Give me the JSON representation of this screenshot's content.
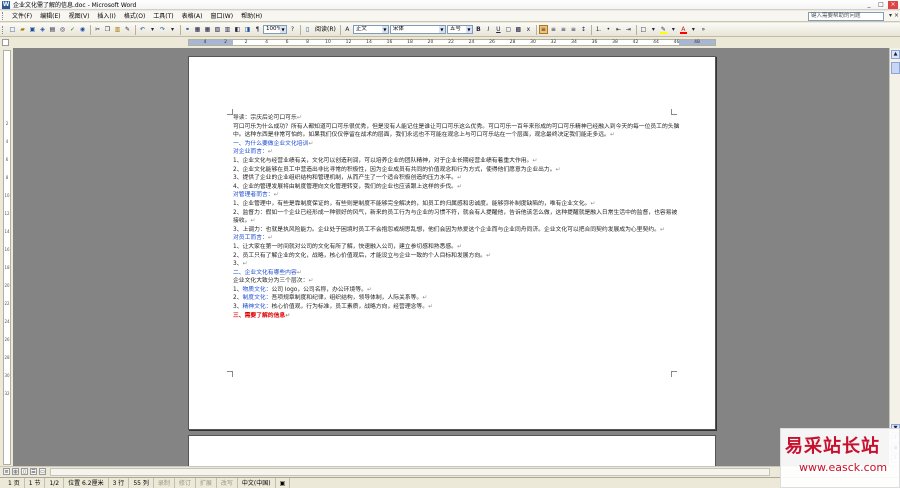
{
  "window": {
    "title": "企业文化需了解的信息.doc - Microsoft Word",
    "controls": [
      "_",
      "□",
      "×"
    ]
  },
  "menu": {
    "items": [
      "文件(F)",
      "编辑(E)",
      "视图(V)",
      "插入(I)",
      "格式(O)",
      "工具(T)",
      "表格(A)",
      "窗口(W)",
      "帮助(H)"
    ],
    "help_placeholder": "键入需要帮助的问题"
  },
  "toolbar": {
    "zoom": "100%",
    "read_label": "阅读(R)",
    "style": "正文",
    "font": "宋体",
    "size": "五号",
    "bold": "B",
    "italic": "I",
    "underline": "U",
    "font_color_label": "A",
    "highlight_color": "#ffff00",
    "font_color": "#ff0000"
  },
  "ruler": {
    "ticks": [
      "4",
      "2",
      "2",
      "4",
      "6",
      "8",
      "10",
      "12",
      "14",
      "16",
      "18",
      "20",
      "22",
      "24",
      "26",
      "28",
      "30",
      "32",
      "34",
      "36",
      "38",
      "42",
      "44",
      "46",
      "48"
    ]
  },
  "vruler": {
    "ticks": [
      "2",
      "4",
      "6",
      "8",
      "10",
      "12",
      "14",
      "16",
      "18",
      "20",
      "22",
      "24",
      "26",
      "28",
      "30",
      "32"
    ]
  },
  "document": {
    "lines": [
      {
        "text": "导读：宗庆后论可口可乐",
        "style": "normal"
      },
      {
        "text": "可口可乐为什么成功？所有人都知道可口可乐很优秀，但是没有人能记住是谁让可口可乐这么优秀。可口可乐一百年来形成的可口可乐精神已经融入到今天的每一位员工的头脑中。这种东西是非常可怕的。如果我们仅仅停留在战术的层面，我们永远也不可能在观念上与可口可乐站在一个层面，观念最终决定我们能走多远。",
        "style": "wrap"
      },
      {
        "text": "一、为什么要做企业文化培训",
        "style": "blue"
      },
      {
        "text": "对企业而言：",
        "style": "blue"
      },
      {
        "text": "1、企业文化与经营业绩有关，文化可以创造利润，可以培养企业的团队精神，对于企业长期经营业绩有着重大作用。",
        "style": "normal"
      },
      {
        "text": "2、企业文化能够在员工中营造出非比寻常的积极性，因为企业成员有共同的价值观念和行为方式，使得他们愿意为企业出力。",
        "style": "normal"
      },
      {
        "text": "3、提供了企业的企业组织结构和管理机制，从而产生了一个适合积极创造的压力水平。",
        "style": "normal"
      },
      {
        "text": "4、企业的管理发展将由制度管理向文化管理转变，我们的企业也应该跟上这样的步伐。",
        "style": "normal"
      },
      {
        "text": "对管理者而言：",
        "style": "blue"
      },
      {
        "text": "1、企业管理中，有些是靠制度保证的，有些则是制度不能够完全解决的，如员工的归属感和忠诚度。能够弥补制度缺陷的，唯有企业文化。",
        "style": "normal"
      },
      {
        "text": "2、监督力：假如一个企业已经形成一种很好的风气，新来的员工行为与企业的习惯不符，就会有人提醒他，告诉他该怎么做，这种提醒就是融入日常生活中的监督，也容易被接收。",
        "style": "wrap"
      },
      {
        "text": "3、上调力：也就是执风险能力。企业处于困境时员工不会抱怨或胡思乱想，他们会因为热爱这个企业而与企业同舟同济。企业文化可以把合同契约发展成为心里契约。",
        "style": "wrap"
      },
      {
        "text": "对员工而言：",
        "style": "blue"
      },
      {
        "text": "1、让大家在第一时间就对公司的文化有所了解，快速融入公司，建立参切感和熟悉感。",
        "style": "normal"
      },
      {
        "text": "2、员工只有了解企业的文化，战略，核心价值观后，才能设立与企业一致的个人目标和发展方向。",
        "style": "normal"
      },
      {
        "text": "3、",
        "style": "normal"
      },
      {
        "text": "二、企业文化有哪些内容",
        "style": "blue"
      },
      {
        "text": "企业文化大致分为三个层次：",
        "style": "normal"
      },
      {
        "text": "1、物质文化：公司 logo，公司名称，办公环境等。",
        "style": "mixed",
        "label": "物质文化："
      },
      {
        "text": "2、制度文化：吾项规章制度和纪律，组织结构，领导体制，人际关系等。",
        "style": "mixed",
        "label": "制度文化："
      },
      {
        "text": "3、精神文化：核心价值观，行为标准，员工素质，战略方向，经营理念等。",
        "style": "mixed",
        "label": "精神文化："
      },
      {
        "text": "三、需要了解的信息",
        "style": "red"
      }
    ]
  },
  "status": {
    "page": "1 页",
    "section": "1 节",
    "pages": "1/2",
    "position": "位置 6.2厘米",
    "line": "3 行",
    "column": "55 列",
    "rec": "录制",
    "trk": "修订",
    "ext": "扩展",
    "ovr": "改写",
    "lang": "中文(中国)"
  },
  "watermark": {
    "text": "易采站长站",
    "url": "www.easck.com"
  }
}
